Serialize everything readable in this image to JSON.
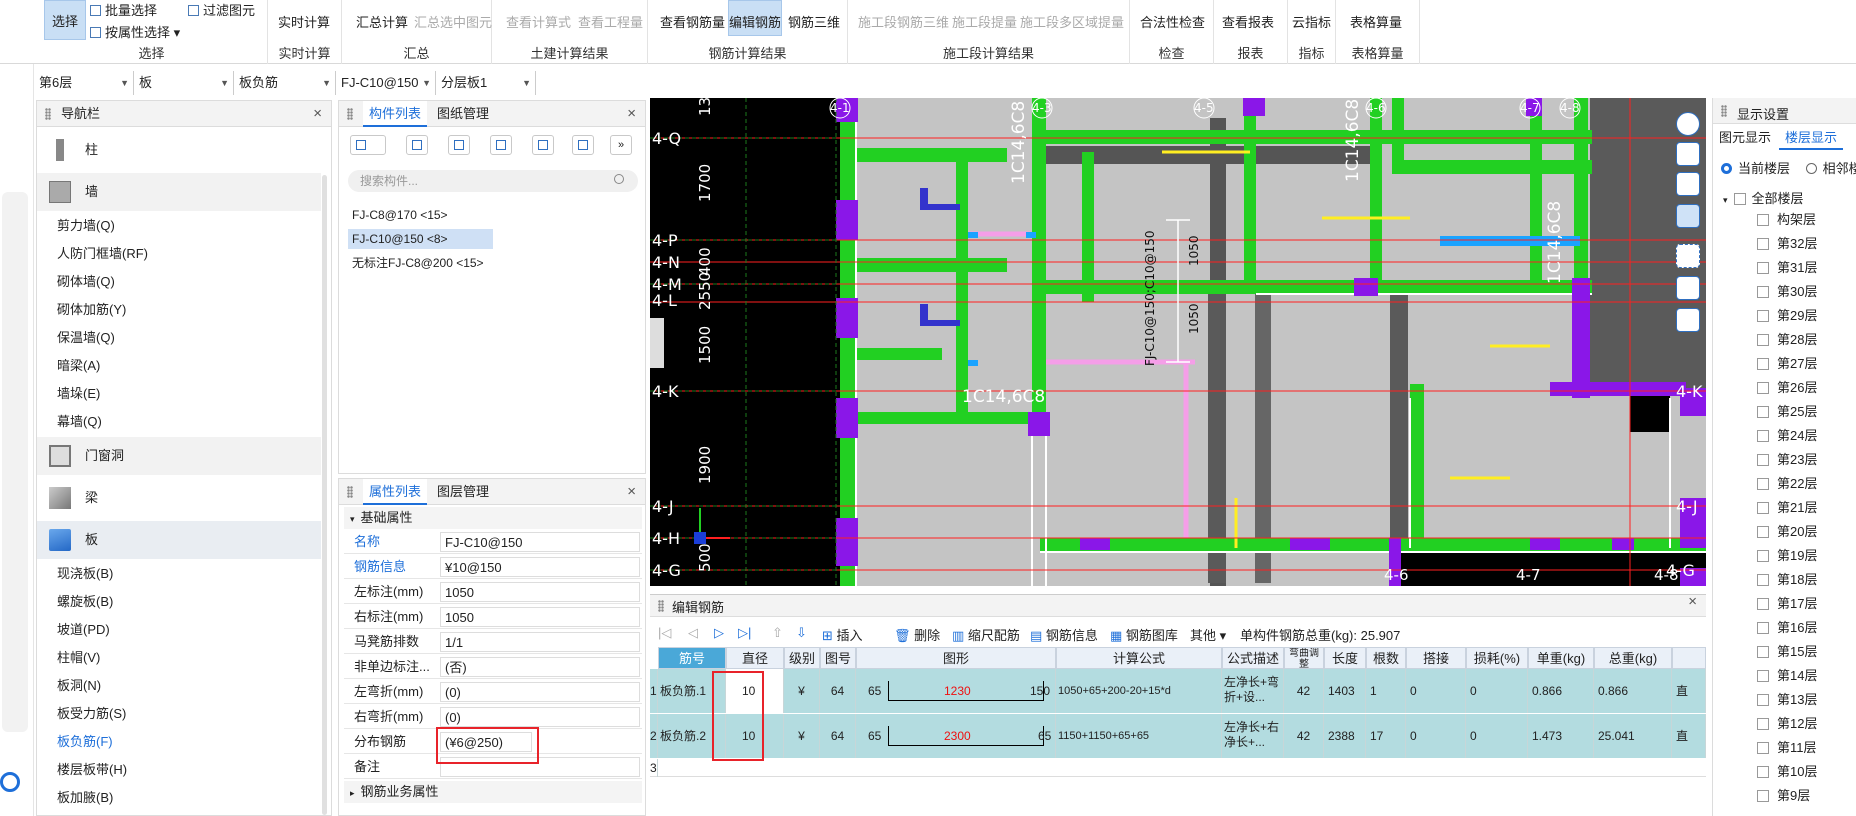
{
  "ribbon": {
    "select": {
      "select_label": "选择",
      "batch_select": "批量选择",
      "filter": "过滤图元",
      "by_attr": "按属性选择",
      "group": "选择"
    },
    "realtime": {
      "calc": "实时计算",
      "group": "实时计算"
    },
    "summary": {
      "calc": "汇总计算",
      "calc_sel": "汇总选中图元",
      "group": "汇总"
    },
    "civil": {
      "view_formula": "查看计算式",
      "view_qty": "查看工程量",
      "group": "土建计算结果"
    },
    "rebar": {
      "view_qty": "查看钢筋量",
      "edit": "编辑钢筋",
      "three_d": "钢筋三维",
      "group": "钢筋计算结果"
    },
    "phase": {
      "three_d": "施工段钢筋三维",
      "extract": "施工段提量",
      "multi": "施工段多区域提量",
      "group": "施工段计算结果"
    },
    "check": {
      "legal": "合法性检查",
      "group": "检查"
    },
    "report": {
      "view": "查看报表",
      "group": "报表"
    },
    "index": {
      "cloud": "云指标",
      "group": "指标"
    },
    "table": {
      "calc": "表格算量",
      "group": "表格算量"
    }
  },
  "selectors": [
    "第6层",
    "板",
    "板负筋",
    "FJ-C10@150",
    "分层板1"
  ],
  "nav": {
    "title": "导航栏",
    "cats": {
      "column": "柱",
      "wall": "墙",
      "door": "门窗洞",
      "beam": "梁",
      "slab": "板"
    },
    "wall_items": [
      "剪力墙(Q)",
      "人防门框墙(RF)",
      "砌体墙(Q)",
      "砌体加筋(Y)",
      "保温墙(Q)",
      "暗梁(A)",
      "墙垛(E)",
      "幕墙(Q)"
    ],
    "slab_items": [
      "现浇板(B)",
      "螺旋板(B)",
      "坡道(PD)",
      "柱帽(V)",
      "板洞(N)",
      "板受力筋(S)",
      "板负筋(F)",
      "楼层板带(H)",
      "板加腋(B)"
    ]
  },
  "complist": {
    "tab1": "构件列表",
    "tab2": "图纸管理",
    "search_placeholder": "搜索构件...",
    "items": [
      "FJ-C8@170 <15>",
      "FJ-C10@150 <8>",
      "无标注FJ-C8@200 <15>"
    ]
  },
  "props": {
    "tab1": "属性列表",
    "tab2": "图层管理",
    "section": "基础属性",
    "section2": "钢筋业务属性",
    "rows": [
      {
        "k": "名称",
        "v": "FJ-C10@150"
      },
      {
        "k": "钢筋信息",
        "v": "¥10@150"
      },
      {
        "k": "左标注(mm)",
        "v": "1050"
      },
      {
        "k": "右标注(mm)",
        "v": "1050"
      },
      {
        "k": "马凳筋排数",
        "v": "1/1"
      },
      {
        "k": "非单边标注...",
        "v": "(否)"
      },
      {
        "k": "左弯折(mm)",
        "v": "(0)"
      },
      {
        "k": "右弯折(mm)",
        "v": "(0)"
      },
      {
        "k": "分布钢筋",
        "v": "(¥6@250)"
      },
      {
        "k": "备注",
        "v": ""
      }
    ]
  },
  "canvas": {
    "left_labels": [
      "4-Q",
      "4-P",
      "4-N",
      "4-M",
      "4-L",
      "4-K",
      "4-J",
      "4-H",
      "4-G"
    ],
    "right_labels": [
      "4-K",
      "4-J",
      "4-G"
    ],
    "dims": [
      "1700",
      "400",
      "2550",
      "1500",
      "1900",
      "500",
      "13"
    ],
    "top_labels": [
      "4-1",
      "4-3",
      "4-5",
      "4-6",
      "4-7",
      "4-8"
    ],
    "bottom_labels": [
      "4-6",
      "4-7",
      "4-8"
    ],
    "annot": [
      "1C14,6C8",
      "1C14,6C8",
      "1C14,6C8",
      "1C14,6C8",
      "FJ-C10@150;C10@150",
      "1050",
      "1050"
    ]
  },
  "rebar_editor": {
    "title": "编辑钢筋",
    "toolbar": [
      "插入",
      "删除",
      "缩尺配筋",
      "钢筋信息",
      "钢筋图库",
      "其他"
    ],
    "total": "单构件钢筋总重(kg): 25.907",
    "headers": [
      "筋号",
      "直径(mm)",
      "级别",
      "图号",
      "图形",
      "计算公式",
      "公式描述",
      "弯曲调整",
      "长度",
      "根数",
      "搭接",
      "损耗(%)",
      "单重(kg)",
      "总重(kg)"
    ],
    "rows": [
      {
        "idx": "1",
        "name": "板负筋.1",
        "dia": "10",
        "grade": "¥",
        "fig": "64",
        "s1": "65",
        "s2": "1230",
        "s3": "150",
        "formula": "1050+65+200-20+15*d",
        "desc": "左净长+弯折+设...",
        "bend": "42",
        "len": "1403",
        "count": "1",
        "lap": "0",
        "loss": "0",
        "unit": "0.866",
        "total": "0.866",
        "tail": "直"
      },
      {
        "idx": "2",
        "name": "板负筋.2",
        "dia": "10",
        "grade": "¥",
        "fig": "64",
        "s1": "65",
        "s2": "2300",
        "s3": "65",
        "formula": "1150+1150+65+65",
        "desc": "左净长+右净长+...",
        "bend": "42",
        "len": "2388",
        "count": "17",
        "lap": "0",
        "loss": "0",
        "unit": "1.473",
        "total": "25.041",
        "tail": "直"
      },
      {
        "idx": "3"
      }
    ]
  },
  "display": {
    "title": "显示设置",
    "tab1": "图元显示",
    "tab2": "楼层显示",
    "radio1": "当前楼层",
    "radio2": "相邻楼",
    "all": "全部楼层",
    "items": [
      "构架层",
      "第32层",
      "第31层",
      "第30层",
      "第29层",
      "第28层",
      "第27层",
      "第26层",
      "第25层",
      "第24层",
      "第23层",
      "第22层",
      "第21层",
      "第20层",
      "第19层",
      "第18层",
      "第17层",
      "第16层",
      "第15层",
      "第14层",
      "第13层",
      "第12层",
      "第11层",
      "第10层",
      "第9层"
    ]
  },
  "colors": {
    "accent": "#1e6fd9",
    "highlight": "#e8232a",
    "grid_row": "#b3dce0"
  }
}
